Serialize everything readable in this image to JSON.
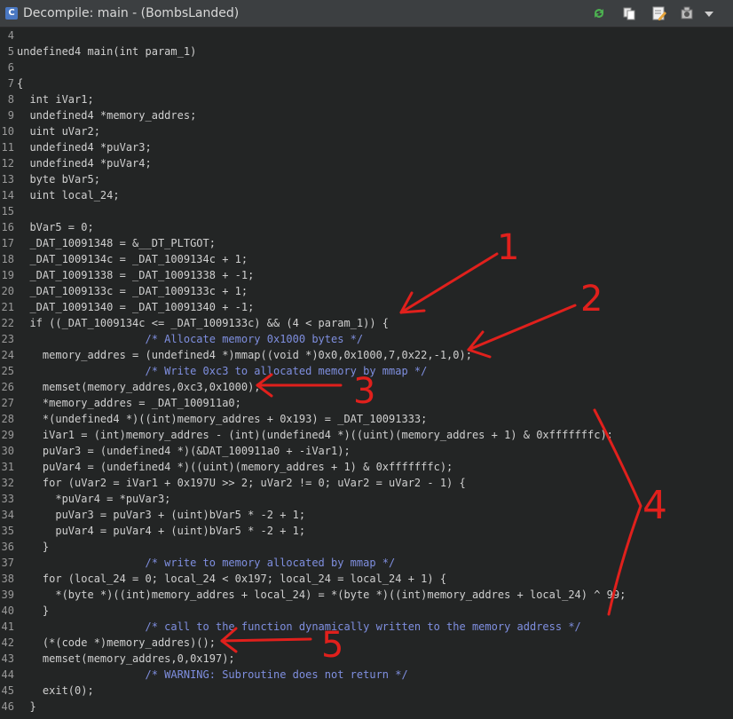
{
  "window": {
    "title": "Decompile: main -  (BombsLanded)",
    "icons": [
      "ghidra-decompiler-icon",
      "refresh-icon",
      "copy-icon",
      "edit-icon",
      "snapshot-icon",
      "dropdown-arrow-icon"
    ]
  },
  "code_lines": [
    {
      "n": "4",
      "t": ""
    },
    {
      "n": "5",
      "t": "undefined4 main(int param_1)"
    },
    {
      "n": "6",
      "t": ""
    },
    {
      "n": "7",
      "t": "{"
    },
    {
      "n": "8",
      "t": "  int iVar1;"
    },
    {
      "n": "9",
      "t": "  undefined4 *memory_addres;"
    },
    {
      "n": "10",
      "t": "  uint uVar2;"
    },
    {
      "n": "11",
      "t": "  undefined4 *puVar3;"
    },
    {
      "n": "12",
      "t": "  undefined4 *puVar4;"
    },
    {
      "n": "13",
      "t": "  byte bVar5;"
    },
    {
      "n": "14",
      "t": "  uint local_24;"
    },
    {
      "n": "15",
      "t": ""
    },
    {
      "n": "16",
      "t": "  bVar5 = 0;"
    },
    {
      "n": "17",
      "t": "  _DAT_10091348 = &__DT_PLTGOT;"
    },
    {
      "n": "18",
      "t": "  _DAT_1009134c = _DAT_1009134c + 1;"
    },
    {
      "n": "19",
      "t": "  _DAT_10091338 = _DAT_10091338 + -1;"
    },
    {
      "n": "20",
      "t": "  _DAT_1009133c = _DAT_1009133c + 1;"
    },
    {
      "n": "21",
      "t": "  _DAT_10091340 = _DAT_10091340 + -1;"
    },
    {
      "n": "22",
      "t": "  if ((_DAT_1009134c <= _DAT_1009133c) && (4 < param_1)) {"
    },
    {
      "n": "23",
      "t": "                    /* Allocate memory 0x1000 bytes */"
    },
    {
      "n": "24",
      "t": "    memory_addres = (undefined4 *)mmap((void *)0x0,0x1000,7,0x22,-1,0);"
    },
    {
      "n": "25",
      "t": "                    /* Write 0xc3 to allocated memory by mmap */"
    },
    {
      "n": "26",
      "t": "    memset(memory_addres,0xc3,0x1000);"
    },
    {
      "n": "27",
      "t": "    *memory_addres = _DAT_100911a0;"
    },
    {
      "n": "28",
      "t": "    *(undefined4 *)((int)memory_addres + 0x193) = _DAT_10091333;"
    },
    {
      "n": "29",
      "t": "    iVar1 = (int)memory_addres - (int)(undefined4 *)((uint)(memory_addres + 1) & 0xfffffffc);"
    },
    {
      "n": "30",
      "t": "    puVar3 = (undefined4 *)(&DAT_100911a0 + -iVar1);"
    },
    {
      "n": "31",
      "t": "    puVar4 = (undefined4 *)((uint)(memory_addres + 1) & 0xfffffffc);"
    },
    {
      "n": "32",
      "t": "    for (uVar2 = iVar1 + 0x197U >> 2; uVar2 != 0; uVar2 = uVar2 - 1) {"
    },
    {
      "n": "33",
      "t": "      *puVar4 = *puVar3;"
    },
    {
      "n": "34",
      "t": "      puVar3 = puVar3 + (uint)bVar5 * -2 + 1;"
    },
    {
      "n": "35",
      "t": "      puVar4 = puVar4 + (uint)bVar5 * -2 + 1;"
    },
    {
      "n": "36",
      "t": "    }"
    },
    {
      "n": "37",
      "t": "                    /* write to memory allocated by mmap */"
    },
    {
      "n": "38",
      "t": "    for (local_24 = 0; local_24 < 0x197; local_24 = local_24 + 1) {"
    },
    {
      "n": "39",
      "t": "      *(byte *)((int)memory_addres + local_24) = *(byte *)((int)memory_addres + local_24) ^ 99;"
    },
    {
      "n": "40",
      "t": "    }"
    },
    {
      "n": "41",
      "t": "                    /* call to the function dynamically written to the memory address */"
    },
    {
      "n": "42",
      "t": "    (*(code *)memory_addres)();"
    },
    {
      "n": "43",
      "t": "    memset(memory_addres,0,0x197);"
    },
    {
      "n": "44",
      "t": "                    /* WARNING: Subroutine does not return */"
    },
    {
      "n": "45",
      "t": "    exit(0);"
    },
    {
      "n": "46",
      "t": "  }"
    }
  ],
  "annotations": {
    "labels": [
      "1",
      "2",
      "3",
      "4",
      "5"
    ],
    "color": "#e0201c"
  },
  "colors": {
    "background": "#232525",
    "comment": "#7f8fe0",
    "text": "#d0d0d0"
  }
}
